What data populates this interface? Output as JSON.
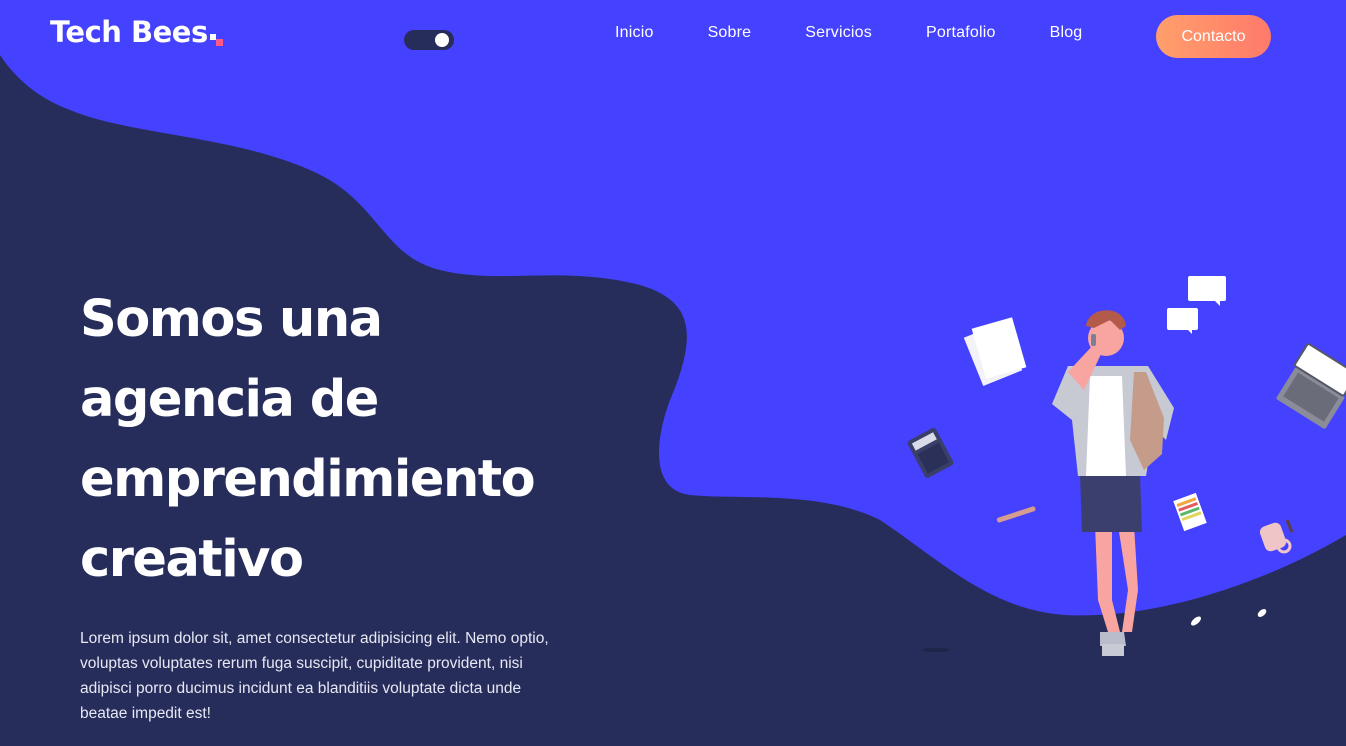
{
  "brand": {
    "name": "Tech Bees"
  },
  "theme_toggle": {
    "state": "on"
  },
  "nav": {
    "items": [
      "Inicio",
      "Sobre",
      "Servicios",
      "Portafolio",
      "Blog"
    ],
    "cta": "Contacto"
  },
  "hero": {
    "title_lines": [
      "Somos una",
      "agencia de",
      "emprendimiento",
      "creativo"
    ],
    "description": "Lorem ipsum dolor sit, amet consectetur adipisicing elit. Nemo optio, voluptas voluptates rerum fuga suscipit, cupiditate provident, nisi adipisci porro ducimus incidunt ea blanditiis voluptate dicta unde beatae impedit est!"
  },
  "colors": {
    "primary_blue": "#4441ff",
    "dark_navy": "#272d5a",
    "cta_start": "#ff9f6b",
    "cta_end": "#ff7a6a",
    "logo_accent": "#ff5a8a"
  },
  "icons": [
    "logo-accent-square",
    "theme-toggle-switch",
    "person-illustration",
    "paper-icon",
    "calculator-icon",
    "laptop-icon",
    "pencil-icon",
    "chat-bubble-icon",
    "mug-icon",
    "color-palette-icon"
  ]
}
